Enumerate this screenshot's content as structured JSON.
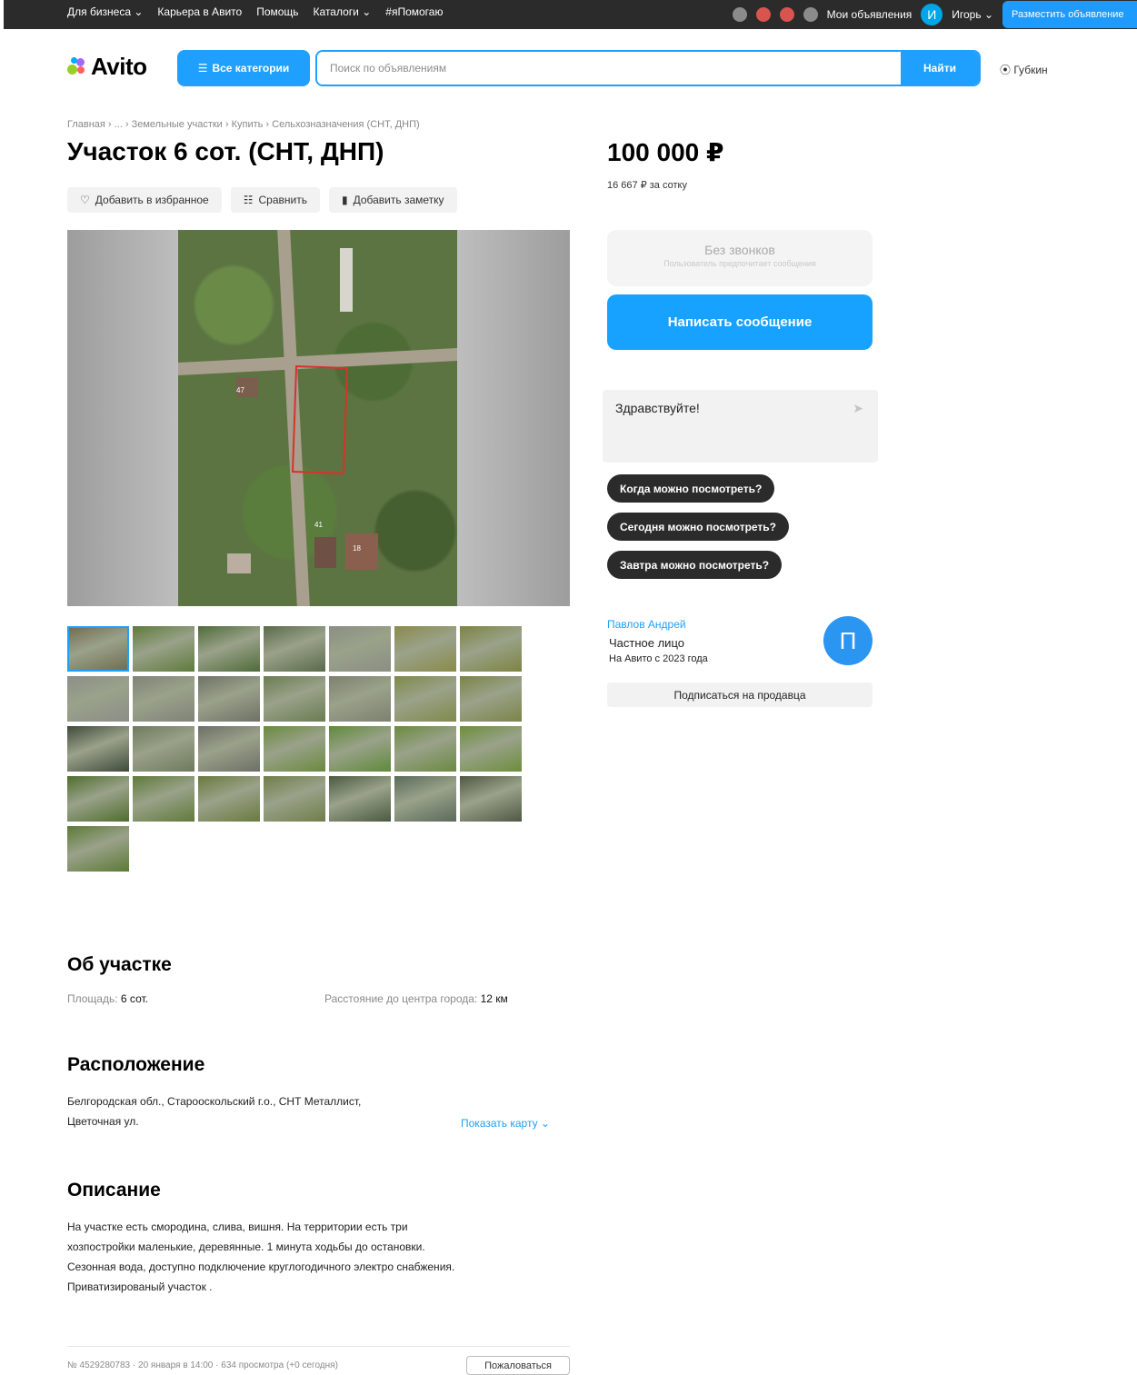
{
  "topbar": {
    "nav": [
      "Для бизнеса ⌄",
      "Карьера в Авито",
      "Помощь",
      "Каталоги ⌄",
      "#яПомогаю"
    ],
    "my_ads": "Мои объявления",
    "user_initial": "И",
    "user_name": "Игорь ⌄",
    "post_ad": "Разместить объявление"
  },
  "header": {
    "logo": "Avito",
    "categories_btn": "Все категории",
    "search_placeholder": "Поиск по объявлениям",
    "search_btn": "Найти",
    "city": "Губкин"
  },
  "breadcrumbs": "Главная › ... › Земельные участки › Купить › Сельхозназначения (СНТ, ДНП)",
  "listing": {
    "title": "Участок 6 сот. (СНТ, ДНП)",
    "actions": [
      "Добавить в избранное",
      "Сравнить",
      "Добавить заметку"
    ]
  },
  "photo": {
    "house_labels": [
      "47",
      "41",
      "18"
    ]
  },
  "thumbnail_colors": [
    "#6f6a4c",
    "#5e7a3c",
    "#4f6b3a",
    "#5a6a4a",
    "#8a8e84",
    "#8a8b4a",
    "#7d8442",
    "#8b8e88",
    "#7f8378",
    "#6f7166",
    "#6b7c52",
    "#7d8070",
    "#7f8a4a",
    "#7c8448",
    "#3f4a3a",
    "#6e7a5c",
    "#6d6f66",
    "#6a8a3e",
    "#5f8a3a",
    "#6a8a40",
    "#6c8e3c",
    "#4f6e2e",
    "#5f7a3a",
    "#6a7a3e",
    "#6f7e4a",
    "#4a5a40",
    "#5a6a5a",
    "#4f5844",
    "#5c7a36"
  ],
  "about": {
    "heading": "Об участке",
    "area_label": "Площадь:",
    "area_value": "6 сот.",
    "distance_label": "Расстояние до центра города:",
    "distance_value": "12 км"
  },
  "location": {
    "heading": "Расположение",
    "address_line1": "Белгородская обл., Старооскольский г.о., СНТ Металлист,",
    "address_line2": "Цветочная ул.",
    "map_link": "Показать карту ⌄"
  },
  "description": {
    "heading": "Описание",
    "line1": "На участке есть смородина, слива, вишня. На территории есть три",
    "line2": "хозпостройки маленькие, деревянные. 1 минута ходьбы до остановки.",
    "line3": "Сезонная вода, доступно подключение круглогодичного электро снабжения.",
    "line4": "Приватизированый участок ."
  },
  "footer": {
    "meta": "№ 4529280783 · 20 января в 14:00 · 634 просмотра (+0 сегодня)",
    "report": "Пожаловаться"
  },
  "sidebar": {
    "price": "100 000 ₽",
    "per_unit": "16 667 ₽ за сотку",
    "no_calls": "Без звонков",
    "no_calls_sub": "Пользователь предпочитает сообщения",
    "write_message": "Написать сообщение",
    "chat_text": "Здравствуйте!",
    "quick_questions": [
      "Когда можно посмотреть?",
      "Сегодня можно посмотреть?",
      "Завтра можно посмотреть?"
    ],
    "seller_name": "Павлов Андрей",
    "seller_type": "Частное лицо",
    "seller_since": "На Авито с 2023 года",
    "seller_initial": "П",
    "subscribe": "Подписаться на продавца"
  }
}
